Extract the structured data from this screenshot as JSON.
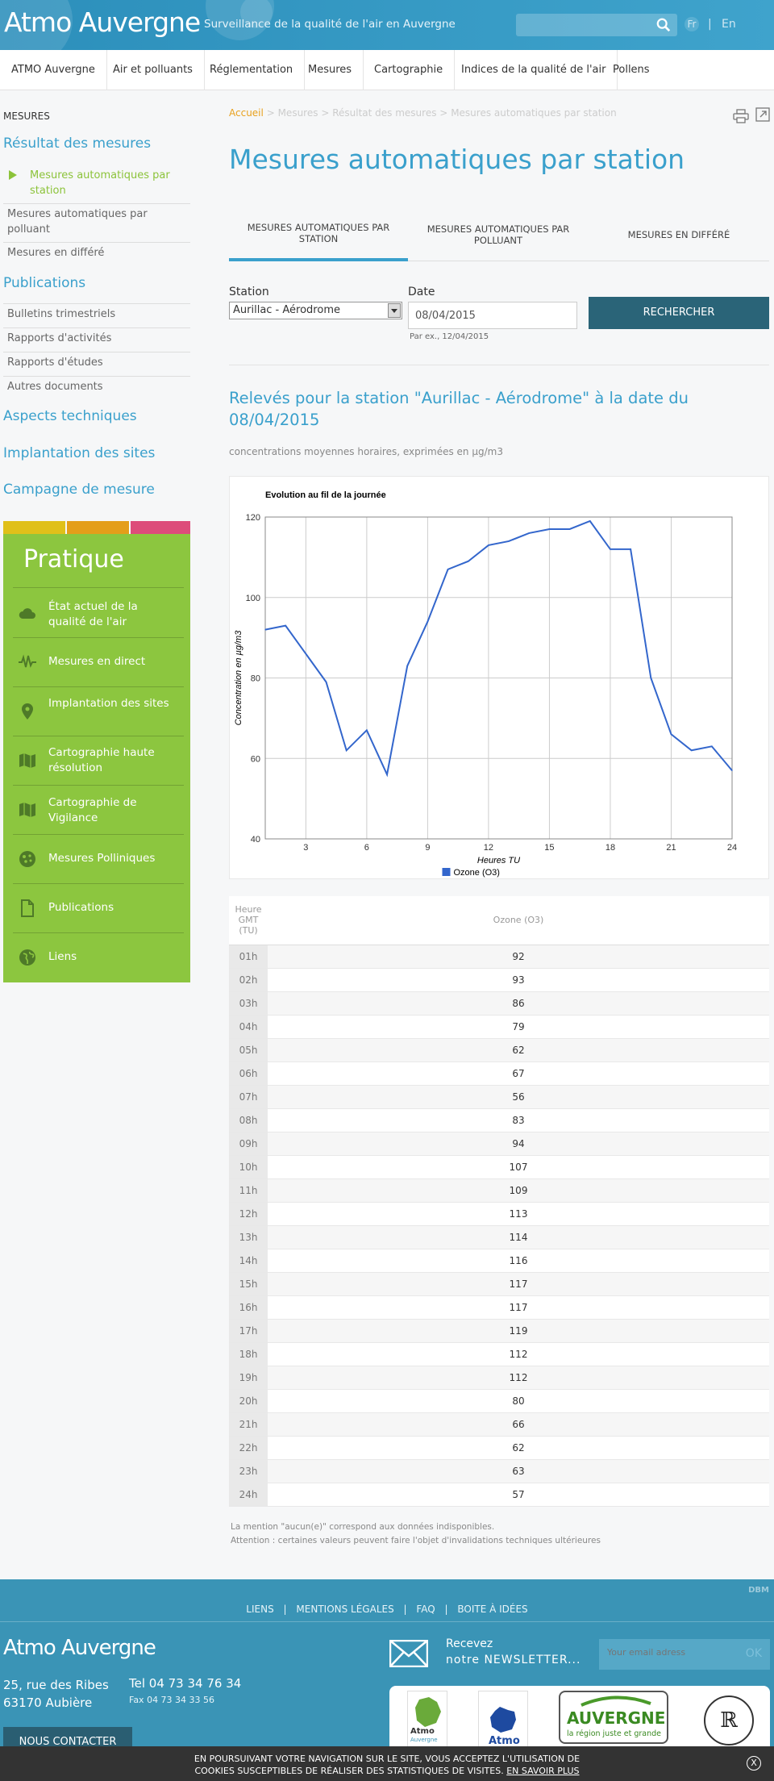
{
  "header": {
    "logo": "Atmo Auvergne",
    "tagline": "Surveillance de la qualité de l'air en Auvergne",
    "search_placeholder": "",
    "lang_fr": "Fr",
    "lang_sep": "|",
    "lang_en": "En"
  },
  "nav": [
    "ATMO Auvergne",
    "Air et polluants",
    "Réglementation",
    "Mesures",
    "Cartographie",
    "Indices de la qualité de l'air",
    "Pollens"
  ],
  "sidebar": {
    "heading": "MESURES",
    "result_cat": "Résultat des mesures",
    "result_items": [
      "Mesures automatiques par station",
      "Mesures automatiques par polluant",
      "Mesures en différé"
    ],
    "pub_cat": "Publications",
    "pub_items": [
      "Bulletins trimestriels",
      "Rapports d'activités",
      "Rapports d'études",
      "Autres documents"
    ],
    "other_cats": [
      "Aspects techniques",
      "Implantation des sites",
      "Campagne de mesure"
    ],
    "color_bars": [
      "#e0c01a",
      "#e49e1a",
      "#dd4c7a"
    ],
    "pratique_title": "Pratique",
    "pratique": [
      {
        "label": "État actuel de la qualité de l'air",
        "icon": "cloud-icon"
      },
      {
        "label": "Mesures en direct",
        "icon": "pulse-icon"
      },
      {
        "label": "Implantation des sites",
        "icon": "location-pin-icon"
      },
      {
        "label": "Cartographie haute résolution",
        "icon": "map-icon"
      },
      {
        "label": "Cartographie de Vigilance",
        "icon": "map-icon"
      },
      {
        "label": "Mesures Polliniques",
        "icon": "pollen-icon"
      },
      {
        "label": "Publications",
        "icon": "document-icon"
      },
      {
        "label": "Liens",
        "icon": "globe-icon"
      }
    ]
  },
  "main": {
    "breadcrumb": [
      "Accueil",
      "Mesures",
      "Résultat des mesures",
      "Mesures automatiques par station"
    ],
    "breadcrumb_sep": ">",
    "title": "Mesures automatiques par station",
    "tabs": [
      "MESURES AUTOMATIQUES PAR STATION",
      "MESURES AUTOMATIQUES PAR POLLUANT",
      "MESURES EN DIFFÉRÉ"
    ],
    "station_label": "Station",
    "station_value": "Aurillac - Aérodrome",
    "date_label": "Date",
    "date_value": "08/04/2015",
    "date_hint": "Par ex., 12/04/2015",
    "search_button": "RECHERCHER",
    "result_title": "Relevés pour la station \"Aurillac - Aérodrome\" à la date du 08/04/2015",
    "result_subtitle": "concentrations moyennes horaires, exprimées en µg/m3",
    "table_header_hour": "Heure GMT (TU)",
    "table_header_val": "Ozone (O3)",
    "notes": [
      "La mention \"aucun(e)\" correspond aux données indisponibles.",
      "Attention : certaines valeurs peuvent faire l'objet d'invalidations techniques ultérieures"
    ]
  },
  "chart_data": {
    "type": "line",
    "title": "Evolution au fil de la journée",
    "xlabel": "Heures TU",
    "ylabel": "Concentration en µg/m3",
    "xlim": [
      1,
      24
    ],
    "ylim": [
      40,
      120
    ],
    "x_ticks": [
      3,
      6,
      9,
      12,
      15,
      18,
      21,
      24
    ],
    "y_ticks": [
      40,
      60,
      80,
      100,
      120
    ],
    "grid": true,
    "legend_position": "bottom",
    "line_color": "#3366cc",
    "series": [
      {
        "name": "Ozone (O3)",
        "hours": [
          "01h",
          "02h",
          "03h",
          "04h",
          "05h",
          "06h",
          "07h",
          "08h",
          "09h",
          "10h",
          "11h",
          "12h",
          "13h",
          "14h",
          "15h",
          "16h",
          "17h",
          "18h",
          "19h",
          "20h",
          "21h",
          "22h",
          "23h",
          "24h"
        ],
        "x": [
          1,
          2,
          3,
          4,
          5,
          6,
          7,
          8,
          9,
          10,
          11,
          12,
          13,
          14,
          15,
          16,
          17,
          18,
          19,
          20,
          21,
          22,
          23,
          24
        ],
        "values": [
          92,
          93,
          86,
          79,
          62,
          67,
          56,
          83,
          94,
          107,
          109,
          113,
          114,
          116,
          117,
          117,
          119,
          112,
          112,
          80,
          66,
          62,
          63,
          57
        ]
      }
    ]
  },
  "footer": {
    "links": [
      "LIENS",
      "MENTIONS LÉGALES",
      "FAQ",
      "BOITE À IDÉES"
    ],
    "link_sep": "|",
    "logo": "Atmo Auvergne",
    "address1": "25, rue des Ribes",
    "address2": "63170 Aubière",
    "tel": "Tel 04 73 34 76 34",
    "fax": "Fax 04 73 34 33 56",
    "contact_button": "NOUS CONTACTER",
    "newsletter_line1": "Recevez",
    "newsletter_line2": "notre NEWSLETTER...",
    "email_placeholder": "Your email adress",
    "ok_button": "OK",
    "partner_region": "AUVERGNE",
    "partner_region_tag": "la région juste et grande",
    "partner_atmo": "Atmo",
    "partner_atmo_auv": "Auvergne",
    "corner_mark": "DBM"
  },
  "cookie": {
    "text1": "EN POURSUIVANT VOTRE NAVIGATION SUR LE SITE, VOUS ACCEPTEZ L'UTILISATION DE",
    "text2": "COOKIES SUSCEPTIBLES DE RÉALISER DES STATISTIQUES DE VISITES.",
    "link": "EN SAVOIR PLUS",
    "close": "X"
  }
}
